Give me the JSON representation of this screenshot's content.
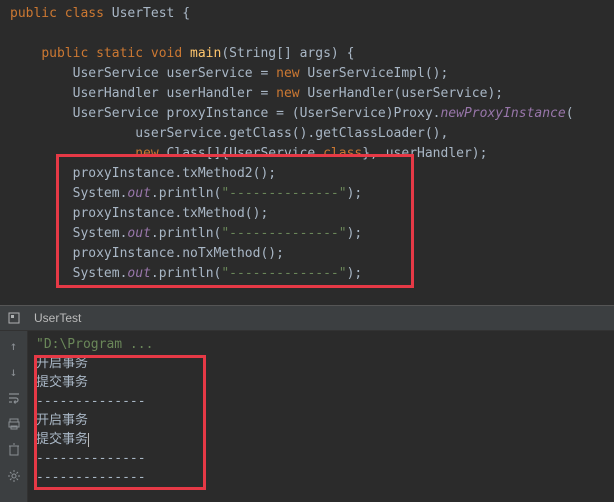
{
  "code": {
    "l1_kw1": "public class",
    "l1_rest": " UserTest {",
    "l3_kw": "public static void",
    "l3_method": " main",
    "l3_rest": "(String[] args) {",
    "l4_a": "UserService userService = ",
    "l4_kw": "new",
    "l4_b": " UserServiceImpl();",
    "l5_a": "UserHandler userHandler = ",
    "l5_kw": "new",
    "l5_b": " UserHandler(userService);",
    "l6_a": "UserService proxyInstance = (UserService)Proxy.",
    "l6_m": "newProxyInstance",
    "l6_b": "(",
    "l7_a": "userService.getClass().getClassLoader(),",
    "l8_kw": "new",
    "l8_a": " Class[]{UserService.",
    "l8_kw2": "class",
    "l8_b": "}, userHandler);",
    "l9": "proxyInstance.txMethod2();",
    "l10_a": "System.",
    "l10_f": "out",
    "l10_b": ".println(",
    "l10_s": "\"--------------\"",
    "l10_c": ");",
    "l11": "proxyInstance.txMethod();",
    "l12_a": "System.",
    "l12_f": "out",
    "l12_b": ".println(",
    "l12_s": "\"--------------\"",
    "l12_c": ");",
    "l13": "proxyInstance.noTxMethod();",
    "l14_a": "System.",
    "l14_f": "out",
    "l14_b": ".println(",
    "l14_s": "\"--------------\"",
    "l14_c": ");"
  },
  "tab": {
    "label": "UserTest"
  },
  "console": {
    "path": "\"D:\\Program ...",
    "o1": "开启事务",
    "o2": "提交事务",
    "o3": "--------------",
    "o4": "开启事务",
    "o5": "提交事务",
    "o6": "--------------",
    "o7": "--------------"
  }
}
